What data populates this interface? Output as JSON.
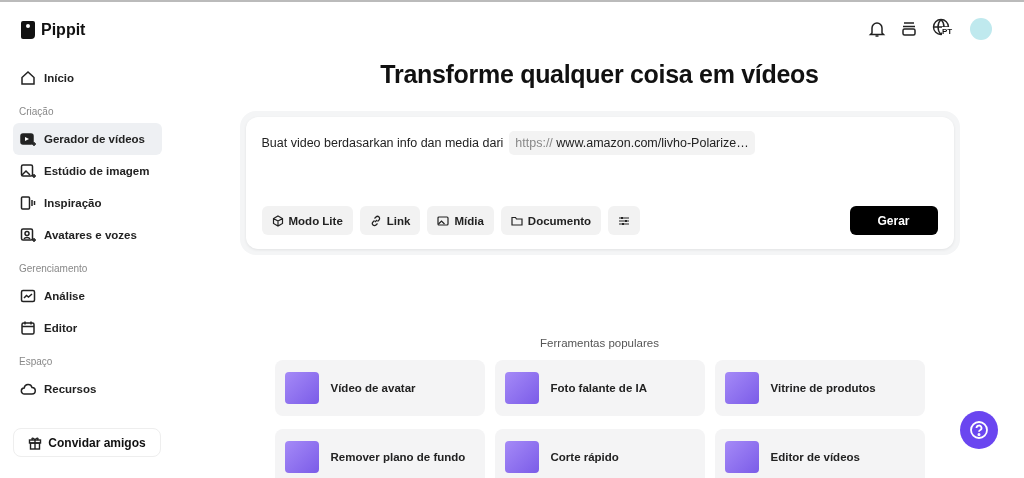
{
  "brand": "Pippit",
  "sidebar": {
    "groups": [
      {
        "items": [
          {
            "label": "Início",
            "kind": "home",
            "selected": false
          }
        ]
      },
      {
        "heading": "Criação",
        "items": [
          {
            "label": "Gerador de vídeos",
            "kind": "video",
            "selected": true
          },
          {
            "label": "Estúdio de imagem",
            "kind": "image",
            "selected": false
          },
          {
            "label": "Inspiração",
            "kind": "inspire",
            "selected": false
          },
          {
            "label": "Avatares e vozes",
            "kind": "avatar",
            "selected": false
          }
        ]
      },
      {
        "heading": "Gerenciamento",
        "items": [
          {
            "label": "Análise",
            "kind": "chart",
            "selected": false
          },
          {
            "label": "Editor",
            "kind": "calendar",
            "selected": false
          }
        ]
      },
      {
        "heading": "Espaço",
        "items": [
          {
            "label": "Recursos",
            "kind": "cloud",
            "selected": false
          }
        ]
      }
    ],
    "invite_button": "Convidar amigos"
  },
  "header": {
    "language": "PT"
  },
  "title": "Transforme qualquer coisa em vídeos",
  "prompt": {
    "text": "Buat video berdasarkan info dan media dari",
    "link_prefix": "https://",
    "link": "www.amazon.com/livho-Polarize…",
    "tools": [
      {
        "label": "Modo Lite",
        "kind": "cube"
      },
      {
        "label": "Link",
        "kind": "link"
      },
      {
        "label": "Mídia",
        "kind": "image"
      },
      {
        "label": "Documento",
        "kind": "folder"
      },
      {
        "kind": "sliders"
      }
    ],
    "submit": "Gerar"
  },
  "popular": {
    "heading": "Ferramentas populares",
    "tools": [
      "Vídeo de avatar",
      "Foto falante de IA",
      "Vitrine de produtos",
      "Remover plano de fundo",
      "Corte rápido",
      "Editor de vídeos"
    ]
  }
}
